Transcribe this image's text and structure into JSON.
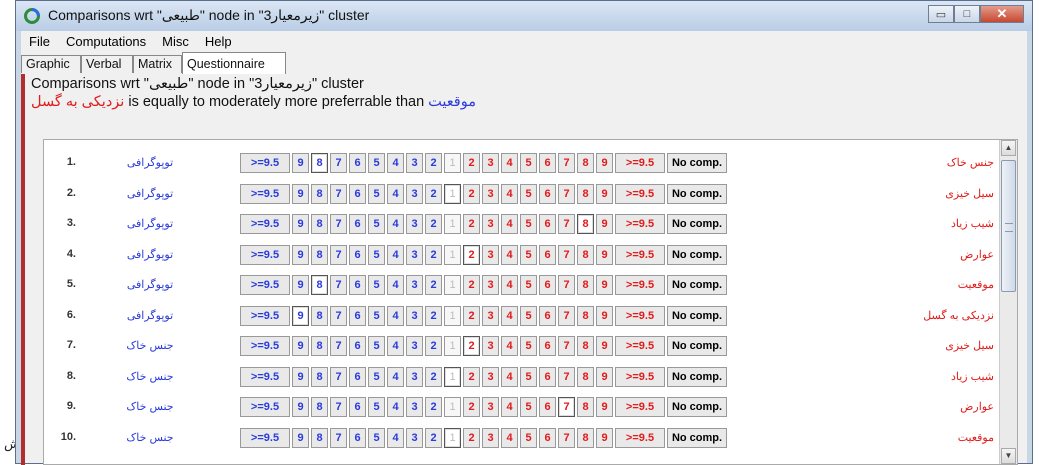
{
  "stray_char": "ش",
  "window": {
    "title": "Comparisons wrt \"طبیعی\" node in \"زیرمعیار3\" cluster",
    "buttons": {
      "minimize": "▭",
      "maximize": "□",
      "close": "✕"
    }
  },
  "menu": [
    "File",
    "Computations",
    "Misc",
    "Help"
  ],
  "tabs": [
    "Graphic",
    "Verbal",
    "Matrix",
    "Questionnaire"
  ],
  "active_tab": "Questionnaire",
  "header": {
    "line1": "Comparisons wrt \"طبیعی\" node in \"زیرمعیار3\" cluster",
    "line2_red": "نزدیکی به گسل",
    "line2_mid": " is equally to moderately more preferrable than ",
    "line2_blue": "موقعیت"
  },
  "scale_labels": [
    ">=9.5",
    "9",
    "8",
    "7",
    "6",
    "5",
    "4",
    "3",
    "2",
    "1",
    "2",
    "3",
    "4",
    "5",
    "6",
    "7",
    "8",
    "9",
    ">=9.5",
    "No comp."
  ],
  "rows": [
    {
      "num": "1.",
      "left": "توپوگرافی",
      "right": "جنس خاک",
      "selected": 2
    },
    {
      "num": "2.",
      "left": "توپوگرافی",
      "right": "سیل خیزی",
      "selected": 9
    },
    {
      "num": "3.",
      "left": "توپوگرافی",
      "right": "شیب زیاد",
      "selected": 16
    },
    {
      "num": "4.",
      "left": "توپوگرافی",
      "right": "عوارض",
      "selected": 10
    },
    {
      "num": "5.",
      "left": "توپوگرافی",
      "right": "موقعیت",
      "selected": 2
    },
    {
      "num": "6.",
      "left": "توپوگرافی",
      "right": "نزدیکی به گسل",
      "selected": 1
    },
    {
      "num": "7.",
      "left": "جنس خاک",
      "right": "سیل خیزی",
      "selected": 10
    },
    {
      "num": "8.",
      "left": "جنس خاک",
      "right": "شیب زیاد",
      "selected": 9
    },
    {
      "num": "9.",
      "left": "جنس خاک",
      "right": "عوارض",
      "selected": 15
    },
    {
      "num": "10.",
      "left": "جنس خاک",
      "right": "موقعیت",
      "selected": 9
    }
  ],
  "scrollbar": {
    "up": "▲",
    "down": "▼"
  }
}
